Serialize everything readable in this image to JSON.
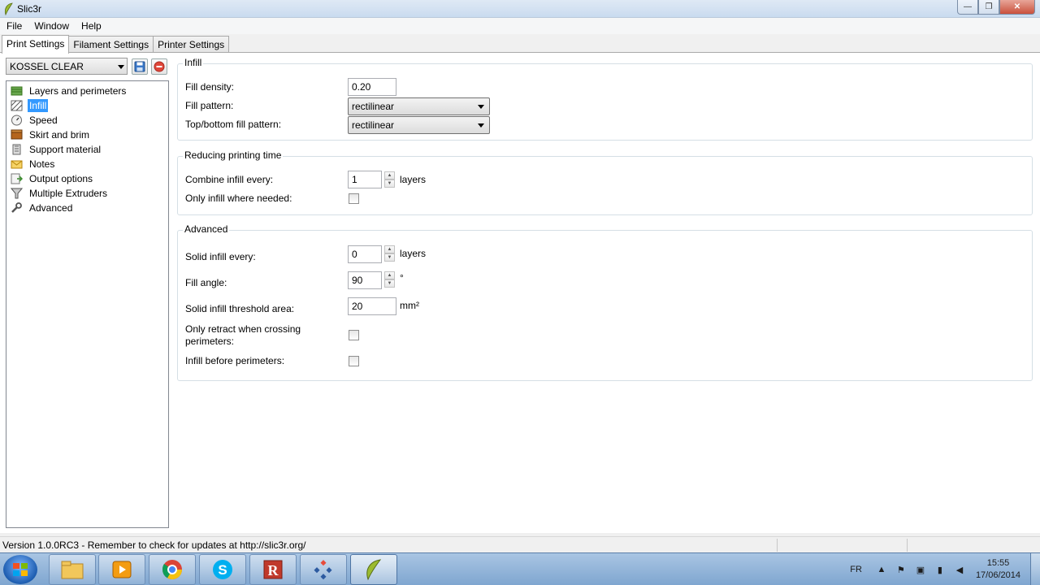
{
  "window": {
    "title": "Slic3r",
    "minimize_glyph": "—",
    "maximize_glyph": "❐",
    "close_glyph": "✕"
  },
  "menu": [
    "File",
    "Window",
    "Help"
  ],
  "tabs": [
    "Print Settings",
    "Filament Settings",
    "Printer Settings"
  ],
  "active_tab": "Print Settings",
  "preset": {
    "value": "KOSSEL CLEAR",
    "save_icon": "save-icon",
    "delete_icon": "delete-icon"
  },
  "sidebar": {
    "items": [
      {
        "label": "Layers and perimeters",
        "icon": "layers-icon"
      },
      {
        "label": "Infill",
        "icon": "infill-icon",
        "selected": true
      },
      {
        "label": "Speed",
        "icon": "speed-icon"
      },
      {
        "label": "Skirt and brim",
        "icon": "skirt-icon"
      },
      {
        "label": "Support material",
        "icon": "support-icon"
      },
      {
        "label": "Notes",
        "icon": "notes-icon"
      },
      {
        "label": "Output options",
        "icon": "output-icon"
      },
      {
        "label": "Multiple Extruders",
        "icon": "extruders-icon"
      },
      {
        "label": "Advanced",
        "icon": "wrench-icon"
      }
    ]
  },
  "infill_group": {
    "title": "Infill",
    "fill_density_label": "Fill density:",
    "fill_density_value": "0.20",
    "fill_pattern_label": "Fill pattern:",
    "fill_pattern_value": "rectilinear",
    "top_bottom_label": "Top/bottom fill pattern:",
    "top_bottom_value": "rectilinear"
  },
  "reducing_group": {
    "title": "Reducing printing time",
    "combine_label": "Combine infill every:",
    "combine_value": "1",
    "combine_unit": "layers",
    "only_infill_label": "Only infill where needed:",
    "only_infill_checked": false
  },
  "advanced_group": {
    "title": "Advanced",
    "solid_every_label": "Solid infill every:",
    "solid_every_value": "0",
    "solid_every_unit": "layers",
    "fill_angle_label": "Fill angle:",
    "fill_angle_value": "90",
    "fill_angle_unit": "°",
    "threshold_label": "Solid infill threshold area:",
    "threshold_value": "20",
    "threshold_unit": "mm²",
    "retract_label_line1": "Only retract when crossing",
    "retract_label_line2": "perimeters:",
    "retract_checked": false,
    "before_perimeters_label": "Infill before perimeters:",
    "before_perimeters_checked": false
  },
  "statusbar": {
    "message": "Version 1.0.0RC3 - Remember to check for updates at http://slic3r.org/"
  },
  "taskbar": {
    "apps": [
      "explorer-icon",
      "media-player-icon",
      "chrome-icon",
      "skype-icon",
      "repetier-icon",
      "app-icon",
      "slic3r-icon"
    ],
    "language": "FR",
    "time": "15:55",
    "date": "17/06/2014"
  }
}
